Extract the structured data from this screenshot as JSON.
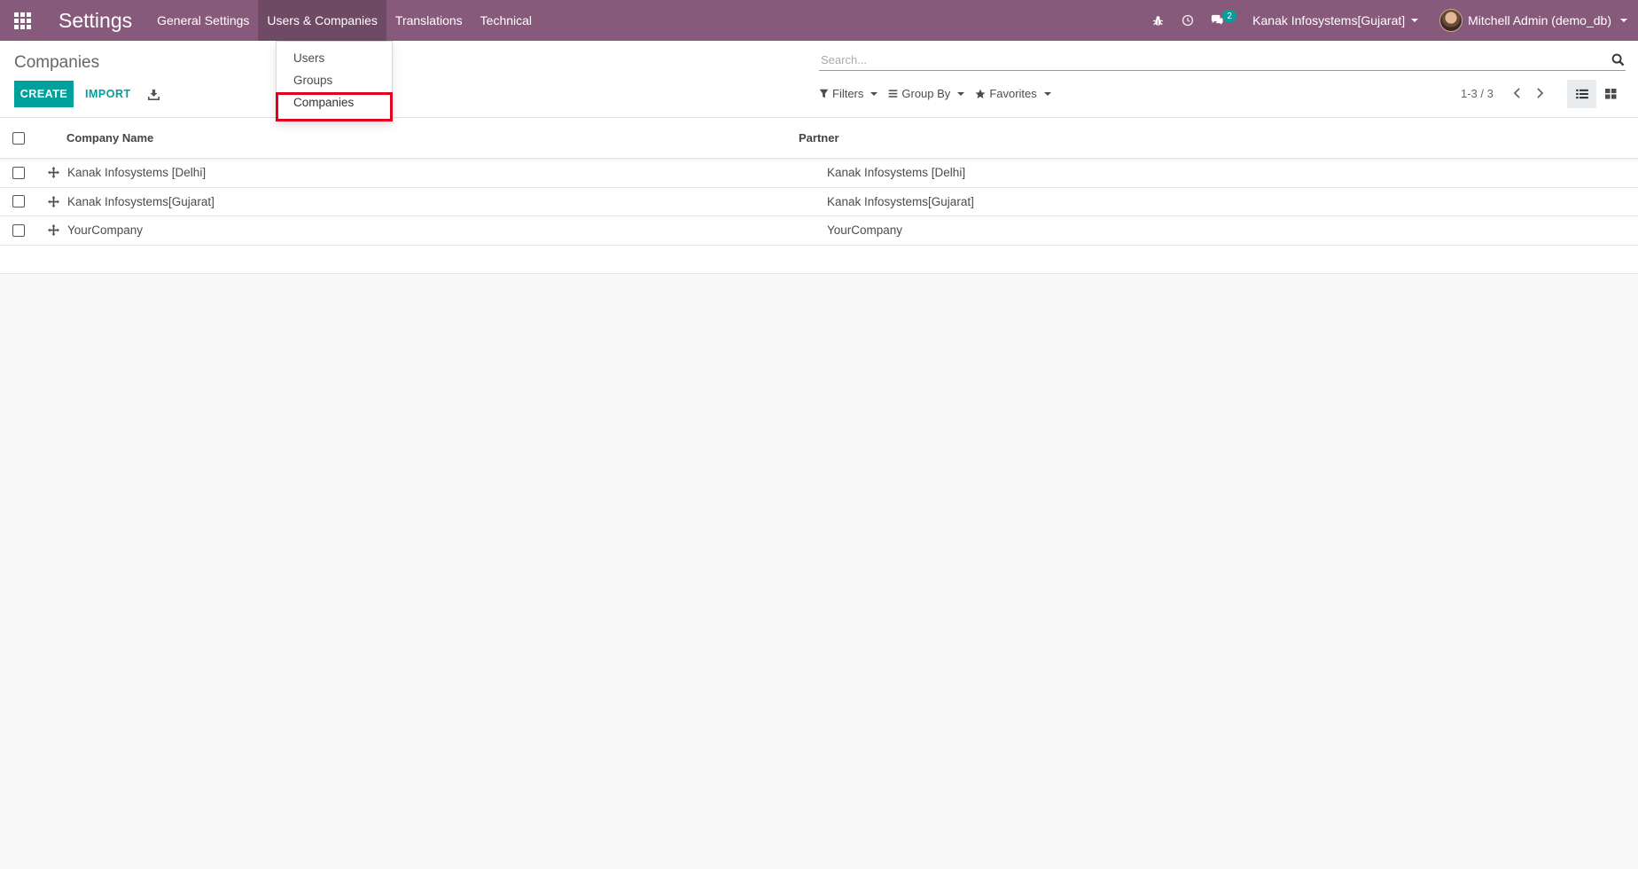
{
  "navbar": {
    "app_title": "Settings",
    "menus": [
      "General Settings",
      "Users & Companies",
      "Translations",
      "Technical"
    ],
    "badge_count": "2",
    "company_switcher": "Kanak Infosystems[Gujarat]",
    "user": "Mitchell Admin (demo_db)",
    "icons": [
      "apps-grid-icon",
      "bug-icon",
      "clock-icon",
      "chat-icon"
    ]
  },
  "dropdown": {
    "items": [
      "Users",
      "Groups",
      "Companies"
    ],
    "highlighted": "Companies"
  },
  "control_panel": {
    "breadcrumb": "Companies",
    "create_label": "CREATE",
    "import_label": "IMPORT",
    "search_placeholder": "Search...",
    "filters_label": "Filters",
    "groupby_label": "Group By",
    "favorites_label": "Favorites",
    "pager": "1-3 / 3"
  },
  "table": {
    "columns": [
      "Company Name",
      "Partner"
    ],
    "rows": [
      [
        "Kanak Infosystems [Delhi]",
        "Kanak Infosystems [Delhi]"
      ],
      [
        "Kanak Infosystems[Gujarat]",
        "Kanak Infosystems[Gujarat]"
      ],
      [
        "YourCompany",
        "YourCompany"
      ]
    ]
  },
  "colors": {
    "navbar": "#875a7b",
    "primary_button": "#00a09d",
    "highlight": "#e0001e"
  }
}
